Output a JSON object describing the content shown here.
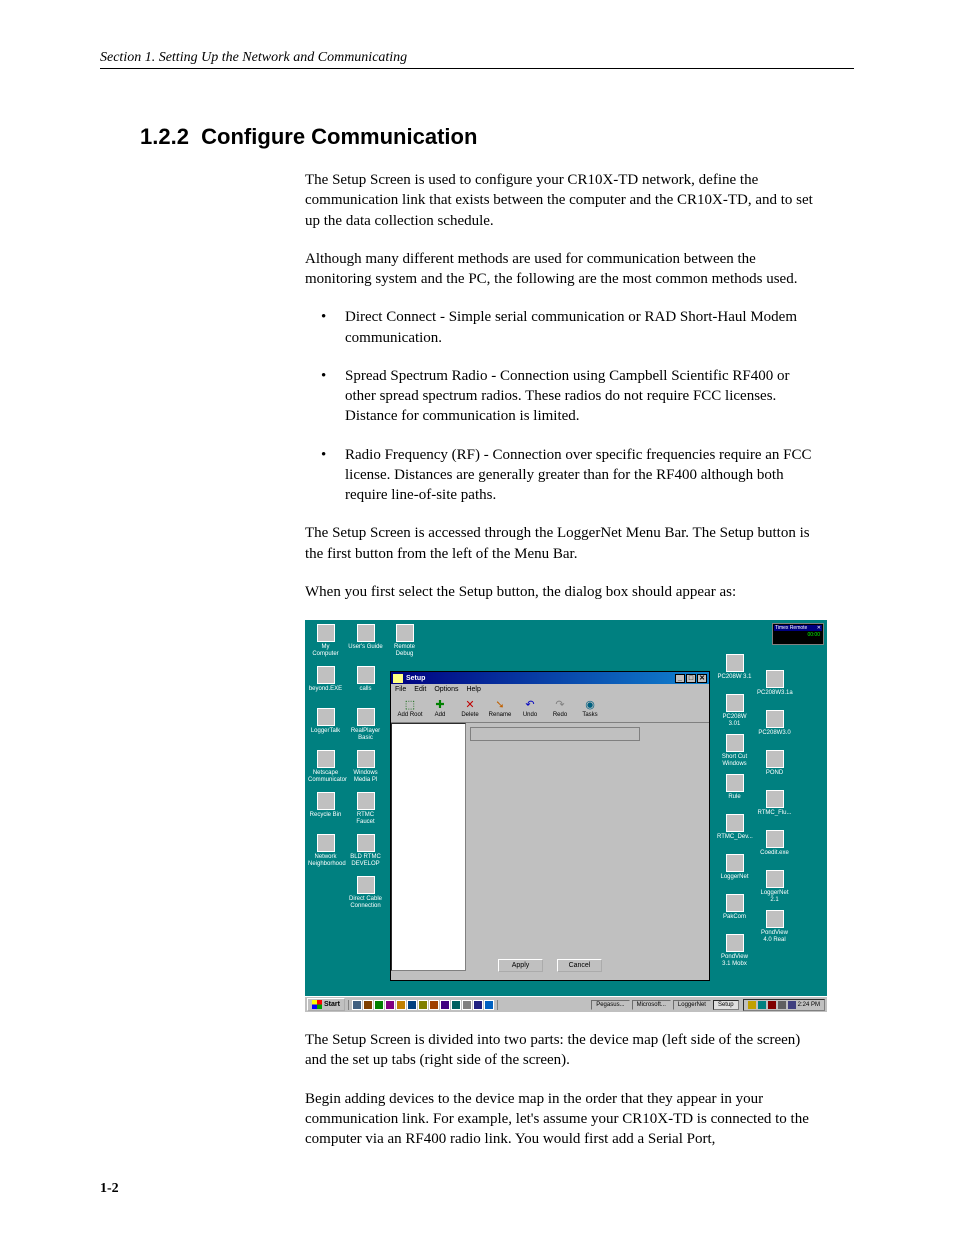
{
  "page": {
    "running_header": "Section 1.  Setting Up the Network and Communicating",
    "section_number": "1.2.2",
    "section_title": "Configure Communication",
    "page_number": "1-2"
  },
  "paragraphs": {
    "p1": "The Setup Screen is used to configure your CR10X-TD network, define the communication link that exists between the computer and the CR10X-TD, and to set up the data collection schedule.",
    "p2": "Although many different methods are used for communication between the monitoring system and the PC, the following are the most common methods used.",
    "p3": "The Setup Screen is accessed through the LoggerNet Menu Bar.  The Setup button is the first button from the left of the Menu Bar.",
    "p4": "When you first select the Setup button, the dialog box should appear as:",
    "p5": "The Setup Screen is divided into two parts: the device map (left side of the screen) and the set up tabs (right side of the screen).",
    "p6": "Begin adding devices to the device map in the order that they appear in your communication link.  For example, let's assume your CR10X-TD is connected to the computer via an RF400 radio link.  You would first add a Serial Port,"
  },
  "bullets": {
    "b1": "Direct Connect - Simple serial communication or RAD Short-Haul Modem communication.",
    "b2": "Spread Spectrum Radio - Connection using Campbell Scientific RF400 or other spread spectrum radios.  These radios do not require FCC licenses.  Distance for communication is limited.",
    "b3": "Radio Frequency (RF) - Connection over specific frequencies require an FCC license.  Distances are generally greater than for the RF400 although both require line-of-site paths."
  },
  "screenshot": {
    "desktop_icons_left": [
      {
        "label": "My Computer"
      },
      {
        "label": "beyond.EXE"
      },
      {
        "label": "LoggerTalk"
      },
      {
        "label": "Netscape Communicator"
      },
      {
        "label": "Recycle Bin"
      },
      {
        "label": "Network Neighborhood"
      }
    ],
    "desktop_icons_col2": [
      {
        "label": "User's Guide"
      },
      {
        "label": "calls"
      },
      {
        "label": "RealPlayer Basic"
      },
      {
        "label": "Windows Media Pl"
      },
      {
        "label": "RTMC Faucet"
      },
      {
        "label": "BLD RTMC DEVELOP"
      },
      {
        "label": "Direct Cable Connection"
      }
    ],
    "desktop_icons_col3": [
      {
        "label": "Remote Debug"
      }
    ],
    "desktop_icons_right": [
      {
        "label": "PC208W 3.1"
      },
      {
        "label": "PC208W 3.01"
      },
      {
        "label": "Short Cut Windows"
      },
      {
        "label": "Rule"
      },
      {
        "label": "RTMC_Dev..."
      },
      {
        "label": "LoggerNet"
      },
      {
        "label": "PakCom"
      },
      {
        "label": "PondView 3.1 Mobx"
      }
    ],
    "desktop_icons_right2": [
      {
        "label": "PC208W3.1a"
      },
      {
        "label": "PC208W3.0"
      },
      {
        "label": "POND"
      },
      {
        "label": "RTMC_Flu..."
      },
      {
        "label": "Coedit.exe"
      },
      {
        "label": "LoggerNet 2.1"
      },
      {
        "label": "PondView 4.0 Real"
      }
    ],
    "setup_window": {
      "title": "Setup",
      "menus": [
        "File",
        "Edit",
        "Options",
        "Help"
      ],
      "toolbar": [
        {
          "label": "Add Root",
          "icon": "⬚"
        },
        {
          "label": "Add",
          "icon": "✚"
        },
        {
          "label": "Delete",
          "icon": "✕"
        },
        {
          "label": "Rename",
          "icon": "➘"
        },
        {
          "label": "Undo",
          "icon": "↶"
        },
        {
          "label": "Redo",
          "icon": "↷"
        },
        {
          "label": "Tasks",
          "icon": "◉"
        }
      ],
      "buttons": {
        "apply": "Apply",
        "cancel": "Cancel"
      }
    },
    "clock": {
      "title": "Timex Remote",
      "time": "00:00"
    },
    "taskbar": {
      "start": "Start",
      "tasks": [
        "Pegasus...",
        "Microsoft...",
        "LoggerNet",
        "Setup"
      ],
      "time": "2:24 PM"
    }
  }
}
